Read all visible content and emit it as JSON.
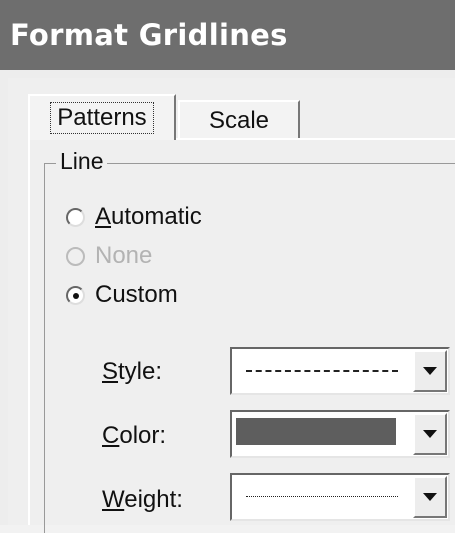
{
  "dialog": {
    "title": "Format Gridlines"
  },
  "tabs": [
    {
      "label": "Patterns",
      "active": true
    },
    {
      "label": "Scale",
      "active": false
    }
  ],
  "line_group": {
    "label": "Line",
    "options": [
      {
        "label_mnemonic": "A",
        "label_rest": "utomatic",
        "checked": false,
        "enabled": true
      },
      {
        "label": "None",
        "checked": false,
        "enabled": false
      },
      {
        "label": "Custom",
        "checked": true,
        "enabled": true
      }
    ],
    "fields": {
      "style": {
        "label_mnemonic": "S",
        "label_rest": "tyle:",
        "value": "dashed"
      },
      "color": {
        "label_mnemonic": "C",
        "label_rest": "olor:",
        "value": "#5e5e5e"
      },
      "weight": {
        "label_mnemonic": "W",
        "label_rest": "eight:",
        "value": "hairline"
      }
    }
  },
  "icons": {
    "dropdown": "triangle-down"
  }
}
